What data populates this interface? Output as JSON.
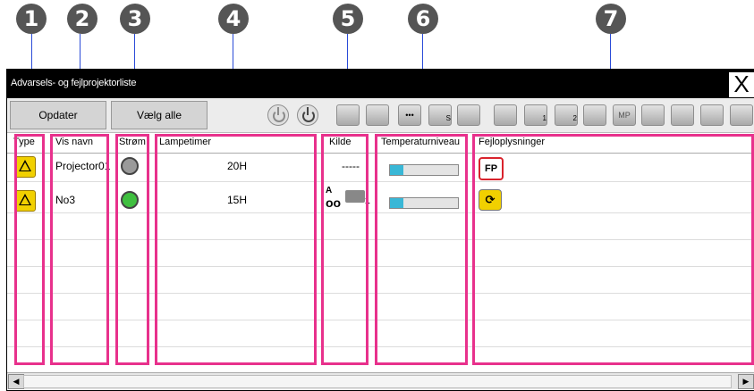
{
  "callouts": [
    "1",
    "2",
    "3",
    "4",
    "5",
    "6",
    "7"
  ],
  "window": {
    "title": "Advarsels- og fejlprojektorliste",
    "close_label": "X"
  },
  "toolbar": {
    "update_label": "Opdater",
    "select_all_label": "Vælg alle",
    "icon_labels": [
      "•••",
      "S",
      "1",
      "2",
      "MP"
    ]
  },
  "columns": [
    "Type",
    "Vis navn",
    "Strøm",
    "Lampetimer",
    "Kilde",
    "Temperaturniveau",
    "Fejloplysninger"
  ],
  "rows": [
    {
      "type_icon": "projector-warning-icon",
      "name": "Projector01",
      "power_icon": "power-warning-icon-gray",
      "lamp": "20H",
      "source": "-----",
      "temperature_level": 0.2,
      "error_icon": "fp-error-icon",
      "error_label": "FP"
    },
    {
      "type_icon": "projector-warning-icon",
      "name": "No3",
      "power_icon": "power-warning-icon-green",
      "lamp": "15H",
      "source_label": "A",
      "source_sub": "1",
      "temperature_level": 0.2,
      "error_icon": "network-error-icon"
    }
  ],
  "colors": {
    "highlight": "#e8318c",
    "callout_line": "#2a4bd8",
    "temp_fill": "#39b7d6",
    "status_yellow": "#f1d000",
    "status_green": "#3fbf3f"
  }
}
